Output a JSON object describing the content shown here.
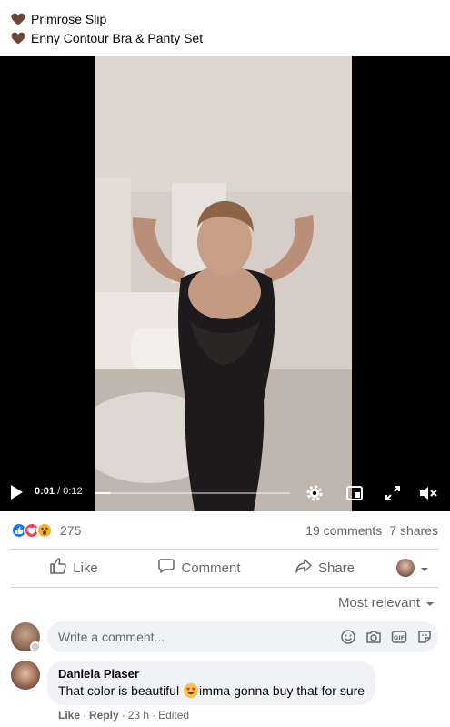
{
  "caption": {
    "lines": [
      "Primrose Slip",
      "Enny Contour Bra & Panty Set"
    ]
  },
  "video": {
    "current_time": "0:01",
    "total_time": "/ 0:12",
    "progress": 0.08
  },
  "stats": {
    "reaction_count": "275",
    "comments": "19 comments",
    "shares": "7 shares"
  },
  "actions": {
    "like": "Like",
    "comment": "Comment",
    "share": "Share"
  },
  "sort": {
    "label": "Most relevant"
  },
  "composer": {
    "placeholder": "Write a comment..."
  },
  "comment": {
    "author": "Daniela Piaser",
    "text_before": "That color is beautiful ",
    "text_after": "imma gonna buy that for sure",
    "like": "Like",
    "reply": "Reply",
    "time": "23 h",
    "edited": "Edited"
  },
  "colors": {
    "text_secondary": "#65676b",
    "like_blue": "#1877f2",
    "heart_brown": "#6b4a3a",
    "divider": "#ced0d4"
  }
}
